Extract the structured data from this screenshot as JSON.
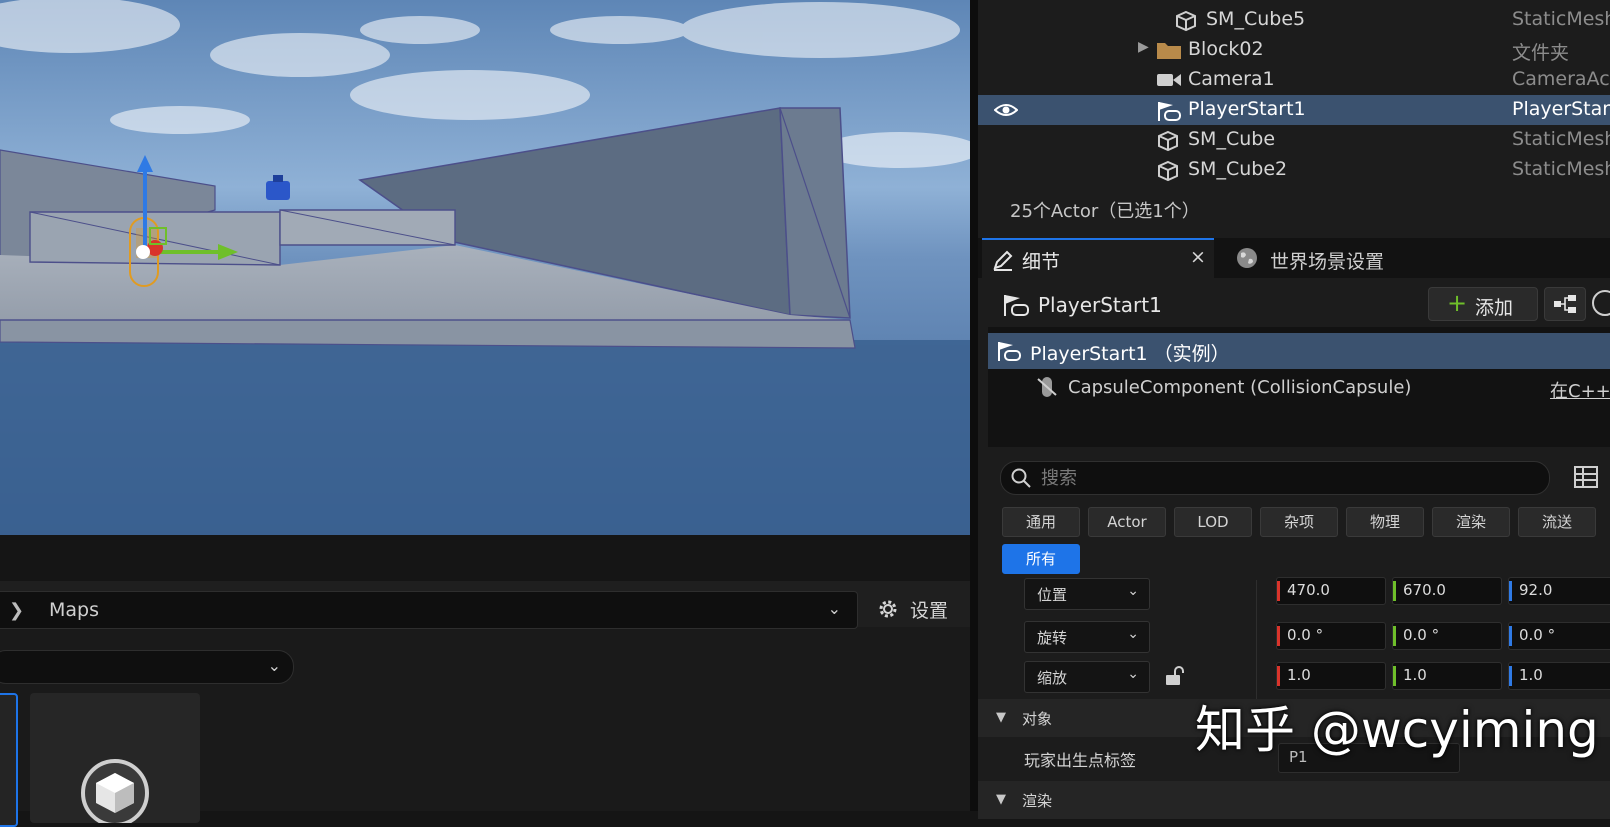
{
  "outliner": {
    "rows": [
      {
        "name": "SM_Cube5",
        "type": "StaticMesh"
      },
      {
        "name": "Block02",
        "type": "文件夹"
      },
      {
        "name": "Camera1",
        "type": "CameraAct"
      },
      {
        "name": "PlayerStart1",
        "type": "PlayerStart"
      },
      {
        "name": "SM_Cube",
        "type": "StaticMesh"
      },
      {
        "name": "SM_Cube2",
        "type": "StaticMesh"
      }
    ],
    "actor_count": "25个Actor（已选1个）"
  },
  "details": {
    "tab_details": "细节",
    "tab_world": "世界场景设置",
    "actor_name": "PlayerStart1",
    "add_label": "添加",
    "components": {
      "root": "PlayerStart1 （实例）",
      "child": "CapsuleComponent (CollisionCapsule)",
      "child_link": "在C++中"
    },
    "search_placeholder": "搜索",
    "filters": [
      "通用",
      "Actor",
      "LOD",
      "杂项",
      "物理",
      "渲染",
      "流送"
    ],
    "filter_all": "所有",
    "transform": {
      "location": {
        "label": "位置",
        "x": "470.0",
        "y": "670.0",
        "z": "92.0"
      },
      "rotation": {
        "label": "旋转",
        "x": "0.0 °",
        "y": "0.0 °",
        "z": "0.0 °"
      },
      "scale": {
        "label": "缩放",
        "x": "1.0",
        "y": "1.0",
        "z": "1.0"
      }
    },
    "section_object": "对象",
    "spawn_tag_label": "玩家出生点标签",
    "spawn_tag_value": "P1",
    "section_render": "渲染"
  },
  "content_browser": {
    "path_folder": "Maps",
    "settings_label": "设置"
  },
  "watermark": "知乎 @wcyiming",
  "colors": {
    "accent": "#1e74e8",
    "selection": "#3b526f",
    "axis_x": "#d9342b",
    "axis_y": "#6fbf2a",
    "axis_z": "#2f7ae5"
  }
}
